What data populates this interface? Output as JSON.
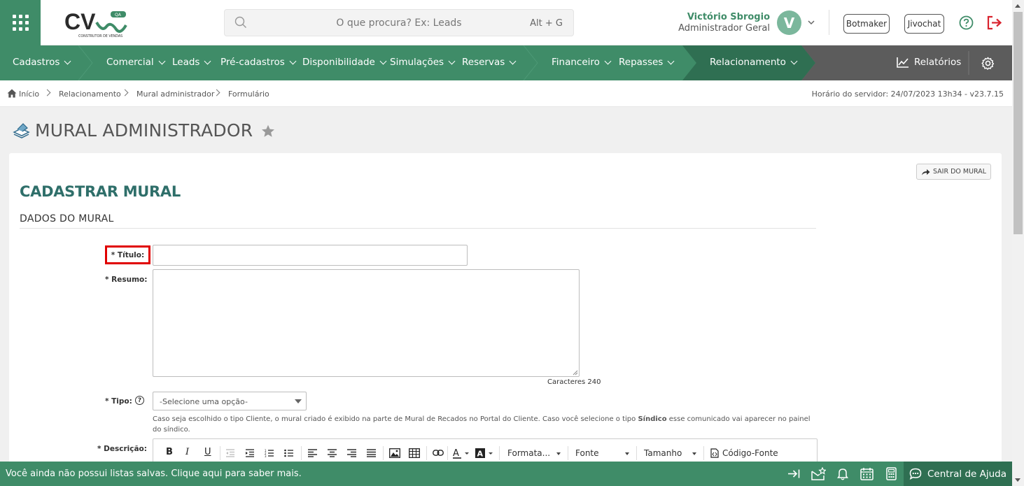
{
  "header": {
    "logo_text": "CV",
    "logo_badge": "QA",
    "logo_subtitle": "CONSTRUTOR DE VENDAS",
    "search_placeholder": "O que procura? Ex: Leads",
    "search_shortcut": "Alt + G",
    "user_name": "Victório Sbrogio",
    "user_role": "Administrador Geral",
    "avatar_initial": "V",
    "botmaker_label": "Botmaker",
    "jivochat_label": "Jivochat"
  },
  "nav": {
    "items": [
      "Cadastros",
      "Comercial",
      "Leads",
      "Pré-cadastros",
      "Disponibilidade",
      "Simulações",
      "Reservas",
      "Financeiro",
      "Repasses",
      "Relacionamento"
    ],
    "reports_label": "Relatórios"
  },
  "breadcrumb": {
    "items": [
      "Início",
      "Relacionamento",
      "Mural administrador",
      "Formulário"
    ],
    "server_time": "Horário do servidor: 24/07/2023 13h34 - v23.7.15"
  },
  "page": {
    "title": "MURAL ADMINISTRADOR",
    "exit_label": "SAIR DO MURAL",
    "section_title": "CADASTRAR MURAL",
    "subsection_title": "DADOS DO MURAL"
  },
  "form": {
    "titulo_label": "* Título:",
    "resumo_label": "* Resumo:",
    "char_count": "Caracteres 240",
    "tipo_label": "* Tipo:",
    "tipo_placeholder": "-Selecione uma opção-",
    "tipo_hint_1": "Caso seja escolhido o tipo Cliente, o mural criado é exibido na parte de Mural de Recados no Portal do Cliente. Caso você selecione o tipo ",
    "tipo_hint_bold": "Síndico",
    "tipo_hint_2": " esse comunicado vai aparecer no painel do síndico.",
    "descricao_label": "* Descrição:",
    "editor": {
      "bold": "B",
      "italic": "I",
      "underline": "U",
      "format_label": "Formata...",
      "font_label": "Fonte",
      "size_label": "Tamanho",
      "source_label": "Código-Fonte"
    }
  },
  "footer": {
    "message": "Você ainda não possui listas salvas. Clique aqui para saber mais.",
    "help_center": "Central de Ajuda"
  },
  "colors": {
    "primary_green": "#3f8c68",
    "dark_green": "#2f6f52",
    "section_title": "#2f6f6a",
    "logout_red": "#d9232e",
    "highlight_red": "#e00000"
  }
}
